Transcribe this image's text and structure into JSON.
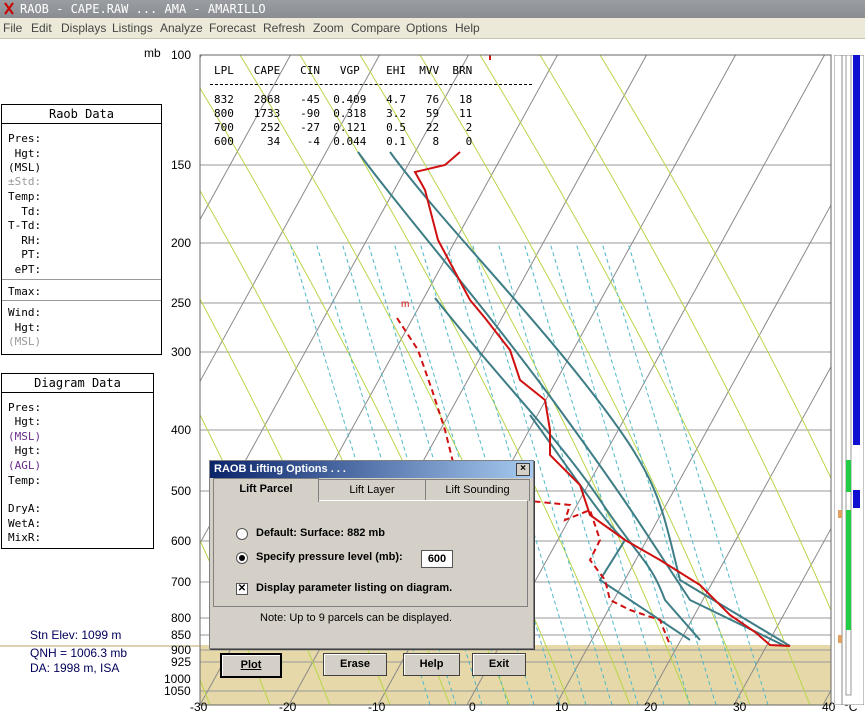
{
  "window": {
    "title": "RAOB - CAPE.RAW ... AMA - AMARILLO"
  },
  "menu": [
    "File",
    "Edit",
    "Displays",
    "Listings",
    "Analyze",
    "Forecast",
    "Refresh",
    "Zoom",
    "Compare",
    "Options",
    "Help"
  ],
  "raob_panel": {
    "title": "Raob Data",
    "fields": [
      "Pres:",
      " Hgt:",
      "(MSL)",
      "±Std:",
      "Temp:",
      "  Td:",
      "T-Td:",
      "  RH:",
      "  PT:",
      " ePT:",
      "Tmax:",
      "Wind:",
      " Hgt:",
      "(MSL)"
    ]
  },
  "diagram_panel": {
    "title": "Diagram Data",
    "fields": [
      "Pres:",
      " Hgt:",
      "(MSL)",
      " Hgt:",
      "(AGL)",
      "Temp:",
      "DryA:",
      "WetA:",
      "MixR:"
    ]
  },
  "axis": {
    "pressure_unit": "mb",
    "pressure_labels": [
      "100",
      "150",
      "200",
      "250",
      "300",
      "400",
      "500",
      "600",
      "700",
      "800",
      "850",
      "900",
      "925",
      "1000",
      "1050"
    ],
    "temp_labels": [
      "-30",
      "-20",
      "-10",
      "0",
      "10",
      "20",
      "30",
      "40"
    ],
    "temp_unit": "°C"
  },
  "station": {
    "elev": "Stn Elev: 1099 m",
    "qnh": "QNH = 1006.3 mb",
    "da": "DA: 1998 m, ISA"
  },
  "parcel_table": {
    "header": "LPL   CAPE   CIN   VGP    EHI  MVV  BRN",
    "rows": [
      "832   2868   -45  0.409   4.7   76   18",
      "800   1733   -90  0.318   3.2   59   11",
      "700    252   -27  0.121   0.5   22    2",
      "600     34    -4  0.044   0.1    8    0"
    ]
  },
  "marker_m": "m",
  "dialog": {
    "title": "RAOB Lifting Options . . .",
    "close": "×",
    "tabs": [
      "Lift Parcel",
      "Lift Layer",
      "Lift Sounding"
    ],
    "active_tab": "Lift Parcel",
    "default_label": "Default:   Surface:  882 mb",
    "specify_label": "Specify pressure level (mb):",
    "specify_value": "600",
    "display_label": "Display parameter listing on diagram.",
    "display_checked": true,
    "note": "Note:  Up to 9 parcels can be displayed.",
    "buttons": {
      "plot": "Plot",
      "erase": "Erase",
      "help": "Help",
      "exit": "Exit"
    }
  },
  "colors": {
    "temp": "#d01010",
    "parcel": "#3e7d86",
    "ground": "#e6d8a8"
  }
}
